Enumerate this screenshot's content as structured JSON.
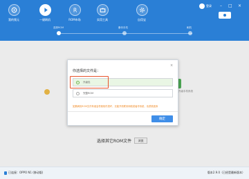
{
  "header": {
    "nav": [
      {
        "label": "我的频元",
        "icon": "play-disc-icon"
      },
      {
        "label": "一键刷机",
        "icon": "flash-icon"
      },
      {
        "label": "ROM市场",
        "icon": "rom-market-icon"
      },
      {
        "label": "实用工具",
        "icon": "toolbox-icon"
      },
      {
        "label": "自用宝",
        "icon": "gear-icon"
      }
    ],
    "user_label": "登录",
    "window_controls": [
      "–",
      "□",
      "×"
    ]
  },
  "steps": [
    {
      "label": "选择ROM",
      "active": true
    },
    {
      "label": "备份手机",
      "active": false
    },
    {
      "label": "刷机",
      "active": false
    }
  ],
  "dialog": {
    "close": "×",
    "title": "你选择的文件是：",
    "options": [
      {
        "text": "升级包",
        "selected": true
      },
      {
        "text": "完整ROM",
        "selected": false
      }
    ],
    "warning": "如果刷机ROM文件有误会导致软件损坏，无能开机联系网络或者作系统，请谨慎选择",
    "ok_label": "确定"
  },
  "main": {
    "select_rom_label": "选择其它ROM文件",
    "browse_label": "浏览",
    "hint_right": "升级手机系统"
  },
  "footer": {
    "device": "已连接：OPPO N1 (移动版)",
    "version": "版本2.9.0（已经是最新版本）"
  },
  "colors": {
    "header_blue": "#2a7fd6",
    "highlight": "#e8532a",
    "ok_button": "#3f8ee8",
    "warning": "#f08a24"
  }
}
